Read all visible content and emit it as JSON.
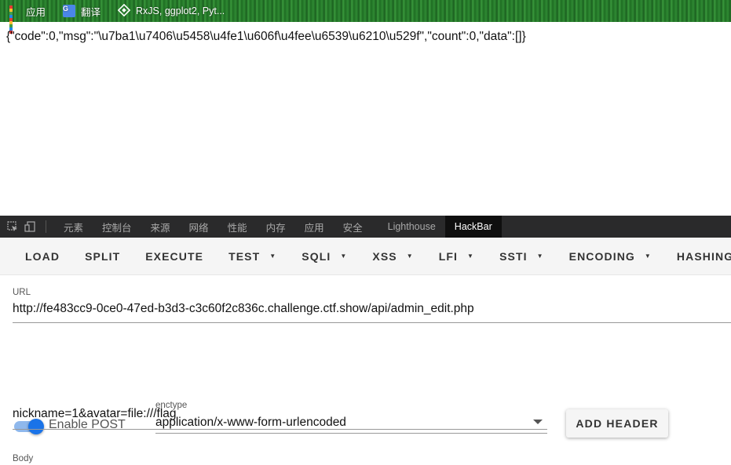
{
  "bookmarks": [
    {
      "label": "应用",
      "icon": "apps-grid-icon"
    },
    {
      "label": "翻译",
      "icon": "translate-icon",
      "icon_text": "G"
    },
    {
      "label": "RxJS, ggplot2, Pyt...",
      "icon": "site-icon"
    }
  ],
  "response": {
    "json_text": "{\"code\":0,\"msg\":\"\\u7ba1\\u7406\\u5458\\u4fe1\\u606f\\u4fee\\u6539\\u6210\\u529f\",\"count\":0,\"data\":[]}"
  },
  "devtools": {
    "tabs": [
      "元素",
      "控制台",
      "来源",
      "网络",
      "性能",
      "内存",
      "应用",
      "安全",
      "Lighthouse",
      "HackBar"
    ],
    "active_tab": "HackBar"
  },
  "hackbar": {
    "buttons": [
      {
        "label": "LOAD",
        "dropdown": false
      },
      {
        "label": "SPLIT",
        "dropdown": false
      },
      {
        "label": "EXECUTE",
        "dropdown": false
      },
      {
        "label": "TEST",
        "dropdown": true
      },
      {
        "label": "SQLI",
        "dropdown": true
      },
      {
        "label": "XSS",
        "dropdown": true
      },
      {
        "label": "LFI",
        "dropdown": true
      },
      {
        "label": "SSTI",
        "dropdown": true
      },
      {
        "label": "ENCODING",
        "dropdown": true
      },
      {
        "label": "HASHING",
        "dropdown": false
      }
    ],
    "url_label": "URL",
    "url_value": "http://fe483cc9-0ce0-47ed-b3d3-c3c60f2c836c.challenge.ctf.show/api/admin_edit.php",
    "enable_post_label": "Enable POST",
    "enable_post_on": true,
    "enctype_label": "enctype",
    "enctype_value": "application/x-www-form-urlencoded",
    "add_header_label": "ADD HEADER",
    "body_label": "Body",
    "body_value": "nickname=1&avatar=file:///flag"
  },
  "colors": {
    "accent": "#1a73e8",
    "devtools_bar": "#2a2a2b",
    "bookmark_bar": "#2f8a33"
  }
}
